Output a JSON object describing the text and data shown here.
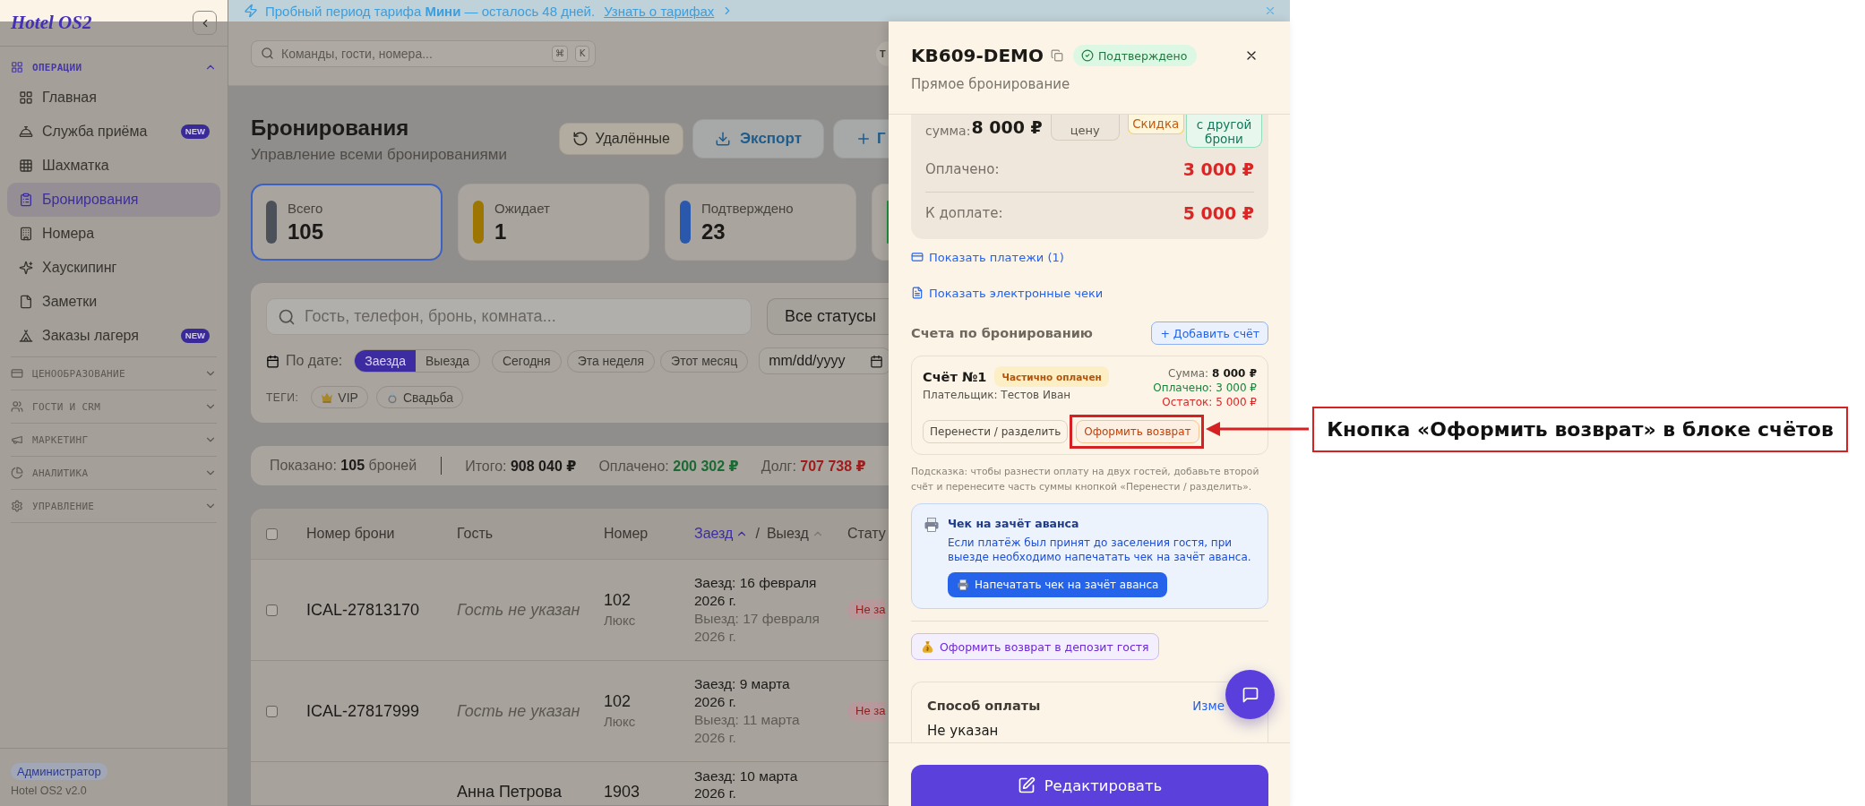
{
  "banner": {
    "message": "Пробный период тарифа **Мини** — осталось 48 дней.",
    "link": "Узнать о тарифах"
  },
  "sidebar": {
    "logo": "Hotel OS2",
    "sections": [
      {
        "title": "ОПЕРАЦИИ",
        "expanded": true,
        "items": [
          {
            "label": "Главная",
            "selected": false
          },
          {
            "label": "Служба приёма",
            "selected": false,
            "badge": "NEW"
          },
          {
            "label": "Шахматка",
            "selected": false
          },
          {
            "label": "Бронирования",
            "selected": true
          },
          {
            "label": "Номера",
            "selected": false
          },
          {
            "label": "Хаускипинг",
            "selected": false
          },
          {
            "label": "Заметки",
            "selected": false
          },
          {
            "label": "Заказы лагеря",
            "selected": false,
            "badge": "NEW"
          }
        ]
      },
      {
        "title": "ЦЕНООБРАЗОВАНИЕ",
        "expanded": false
      },
      {
        "title": "ГОСТИ И CRM",
        "expanded": false
      },
      {
        "title": "МАРКЕТИНГ",
        "expanded": false
      },
      {
        "title": "АНАЛИТИКА",
        "expanded": false
      },
      {
        "title": "УПРАВЛЕНИЕ",
        "expanded": false
      }
    ],
    "role": "Администратор",
    "version": "Hotel OS2 v2.0"
  },
  "topbar": {
    "search": {
      "placeholder": "Команды, гости, номера..."
    },
    "shortcut": [
      "⌘",
      "K"
    ],
    "avatar": "Т"
  },
  "page": {
    "title": "Бронирования",
    "subtitle": "Управление всеми бронированиями",
    "actions": [
      {
        "kind": "deleted",
        "label": "Удалённые"
      },
      {
        "kind": "export",
        "label": "Экспорт"
      },
      {
        "kind": "create",
        "label": "Г"
      }
    ]
  },
  "stats": [
    {
      "label": "Всего",
      "value": "105",
      "color": "#4b5059",
      "selected": true
    },
    {
      "label": "Ожидает",
      "value": "1",
      "color": "#9c7600",
      "selected": false
    },
    {
      "label": "Подтверждено",
      "value": "23",
      "color": "#2a58ad",
      "selected": false
    },
    {
      "color": "#1f8f3e",
      "selected": false
    }
  ],
  "filters": {
    "search": {
      "placeholder": "Гость, телефон, бронь, комната..."
    },
    "status": "Все статусы",
    "date_label": "По дате:",
    "date_modes": [
      {
        "label": "Заезда",
        "selected": true
      },
      {
        "label": "Выезда",
        "selected": false
      }
    ],
    "presets": [
      "Сегодня",
      "Эта неделя",
      "Этот месяц"
    ],
    "date": {
      "placeholder": "mm/dd/yyyy"
    },
    "tags_label": "ТЕГИ:",
    "tags": [
      "VIP",
      "Свадьба"
    ]
  },
  "summary": [
    {
      "kind": "count",
      "label": "Показано:",
      "value": "105",
      "suffix": "броней"
    },
    {
      "kind": "total",
      "label": "Итого:",
      "value": "908 040 ₽"
    },
    {
      "kind": "paid",
      "label": "Оплачено:",
      "value": "200 302 ₽"
    },
    {
      "kind": "debt",
      "label": "Долг:",
      "value": "707 738 ₽"
    }
  ],
  "table": {
    "select_all": {
      "checked": false
    },
    "columns": [
      {
        "kind": "text",
        "label": "Номер брони"
      },
      {
        "kind": "text",
        "label": "Гость"
      },
      {
        "kind": "text",
        "label": "Номер"
      },
      {
        "kind": "sort",
        "parts": [
          {
            "label": "Заезд",
            "sorted": true
          },
          {
            "label": "Выезд",
            "sorted": false
          }
        ],
        "separator": "/"
      },
      {
        "kind": "text",
        "label": "Стату"
      }
    ],
    "rows": [
      {
        "checked": false,
        "booking": "ICAL-27813170",
        "guest": "Гость не указан",
        "unknown_guest": true,
        "room": "102",
        "room_type": "Люкс",
        "check_in": "Заезд: 16 февраля 2026 г.",
        "check_out": "Выезд: 17 февраля 2026 г.",
        "status": "Не за"
      },
      {
        "checked": false,
        "booking": "ICAL-27817999",
        "guest": "Гость не указан",
        "unknown_guest": true,
        "room": "102",
        "room_type": "Люкс",
        "check_in": "Заезд: 9 марта 2026 г.",
        "check_out": "Выезд: 11 марта 2026 г.",
        "status": "Не за"
      },
      {
        "guest": "Анна Петрова",
        "unknown_guest": false,
        "room": "1903",
        "check_in": "Заезд: 10 марта 2026 г."
      }
    ]
  },
  "drawer": {
    "title": "KB609-DEMO",
    "status": "Подтверждено",
    "source": "Прямое бронирование",
    "price": {
      "total_label": "сумма:",
      "total": "8 000 ₽",
      "change_price": "цену",
      "discount": "Скидка",
      "transfer": "с другой брони",
      "paid_label": "Оплачено:",
      "paid": "3 000 ₽",
      "due_label": "К доплате:",
      "due": "5 000 ₽"
    },
    "links": [
      {
        "kind": "payments",
        "label": "Показать платежи (1)"
      },
      {
        "kind": "receipts",
        "label": "Показать электронные чеки"
      }
    ],
    "invoices_title": "Счета по бронированию",
    "add_invoice": "+ Добавить счёт",
    "invoices": [
      {
        "title": "Счёт №1",
        "status": "Частично оплачен",
        "payer": "Плательщик: Тестов Иван",
        "sum": "Сумма: **8 000 ₽**",
        "paid": "Оплачено: 3 000 ₽",
        "rest": "Остаток: 5 000 ₽",
        "actions": [
          {
            "kind": "neutral",
            "label": "Перенести / разделить",
            "highlighted": false
          },
          {
            "kind": "refund",
            "label": "Оформить возврат",
            "highlighted": true
          }
        ]
      }
    ],
    "hint": "Подсказка: чтобы разнести оплату на двух гостей, добавьте второй счёт и перенесите часть суммы кнопкой «Перенести / разделить».",
    "notice": {
      "title": "Чек на зачёт аванса",
      "text": "Если платёж был принят до заселения гостя, при выезде необходимо напечатать чек на зачёт аванса.",
      "button": "Напечатать чек на зачёт аванса"
    },
    "deposit_button": "Оформить возврат в депозит гостя",
    "payment_method": {
      "title": "Способ оплаты",
      "link": "Изме",
      "value": "Не указан"
    },
    "edit_button": "Редактировать"
  },
  "annotation": {
    "text": "Кнопка «Оформить возврат» в блоке счётов"
  }
}
